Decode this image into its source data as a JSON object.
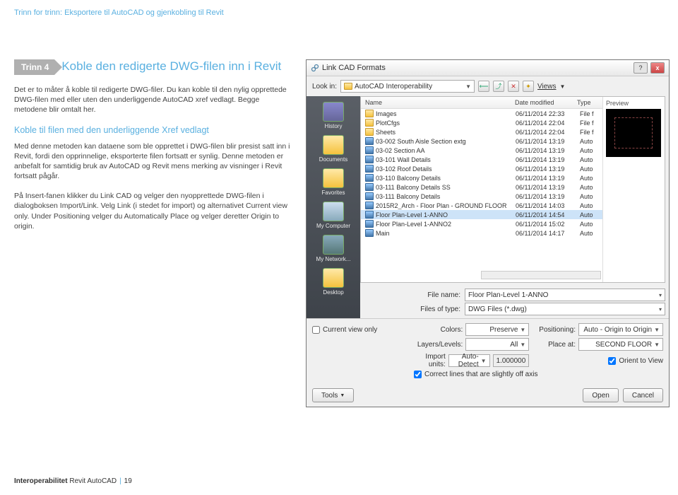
{
  "page": {
    "header": "Trinn for trinn: Eksportere til AutoCAD og gjenkobling til Revit",
    "footer_bold": "Interoperabilitet",
    "footer_regular": " Revit AutoCAD",
    "footer_page": "19"
  },
  "step": {
    "badge": "Trinn 4",
    "title": "Koble den redigerte DWG-filen inn i Revit",
    "p1": "Det er to måter å koble til redigerte DWG-filer. Du kan koble til den nylig opprettede DWG-filen med eller uten den underliggende AutoCAD xref vedlagt. Begge metodene blir omtalt her.",
    "sub2": "Koble til filen med den underliggende Xref vedlagt",
    "p2": "Med denne metoden kan dataene som ble opprettet i DWG-filen blir presist satt inn i Revit, fordi den opprinnelige, eksporterte filen fortsatt er synlig. Denne metoden er anbefalt for samtidig bruk av AutoCAD og Revit mens merking av visninger i Revit fortsatt pågår.",
    "p3": "På Insert-fanen klikker du Link CAD og velger den nyopprettede DWG-filen i dialogboksen Import/Link. Velg Link (i stedet for import) og alternativet Current view only. Under Positioning velger du Automatically Place og velger deretter Origin to origin."
  },
  "dialog": {
    "title": "Link CAD Formats",
    "lookin_label": "Look in:",
    "lookin_value": "AutoCAD Interoperability",
    "views_label": "Views",
    "preview_label": "Preview",
    "places": {
      "history": "History",
      "documents": "Documents",
      "favorites": "Favorites",
      "mycomputer": "My Computer",
      "mynetwork": "My Network...",
      "desktop": "Desktop"
    },
    "cols": {
      "name": "Name",
      "date": "Date modified",
      "type": "Type"
    },
    "files": [
      {
        "icon": "folder",
        "name": "Images",
        "date": "06/11/2014 22:33",
        "type": "File f"
      },
      {
        "icon": "folder",
        "name": "PlotCfgs",
        "date": "06/11/2014 22:04",
        "type": "File f"
      },
      {
        "icon": "folder",
        "name": "Sheets",
        "date": "06/11/2014 22:04",
        "type": "File f"
      },
      {
        "icon": "dwg",
        "name": "03-002 South Aisle Section extg",
        "date": "06/11/2014 13:19",
        "type": "Auto"
      },
      {
        "icon": "dwg",
        "name": "03-02 Section AA",
        "date": "06/11/2014 13:19",
        "type": "Auto"
      },
      {
        "icon": "dwg",
        "name": "03-101 Wall Details",
        "date": "06/11/2014 13:19",
        "type": "Auto"
      },
      {
        "icon": "dwg",
        "name": "03-102 Roof Details",
        "date": "06/11/2014 13:19",
        "type": "Auto"
      },
      {
        "icon": "dwg",
        "name": "03-110 Balcony Details",
        "date": "06/11/2014 13:19",
        "type": "Auto"
      },
      {
        "icon": "dwg",
        "name": "03-111 Balcony Details SS",
        "date": "06/11/2014 13:19",
        "type": "Auto"
      },
      {
        "icon": "dwg",
        "name": "03-111 Balcony Details",
        "date": "06/11/2014 13:19",
        "type": "Auto"
      },
      {
        "icon": "dwg",
        "name": "2015R2_Arch - Floor Plan - GROUND FLOOR",
        "date": "06/11/2014 14:03",
        "type": "Auto"
      },
      {
        "icon": "dwg",
        "name": "Floor Plan-Level 1-ANNO",
        "date": "06/11/2014 14:54",
        "type": "Auto",
        "selected": true
      },
      {
        "icon": "dwg",
        "name": "Floor Plan-Level 1-ANNO2",
        "date": "06/11/2014 15:02",
        "type": "Auto"
      },
      {
        "icon": "dwg",
        "name": "Main",
        "date": "06/11/2014 14:17",
        "type": "Auto"
      }
    ],
    "filename_label": "File name:",
    "filename_value": "Floor Plan-Level 1-ANNO",
    "filetype_label": "Files of type:",
    "filetype_value": "DWG Files (*.dwg)",
    "opts": {
      "current_view": "Current view only",
      "colors_label": "Colors:",
      "colors_value": "Preserve",
      "layers_label": "Layers/Levels:",
      "layers_value": "All",
      "import_units_label": "Import units:",
      "import_units_value": "Auto-Detect",
      "units_factor": "1.000000",
      "positioning_label": "Positioning:",
      "positioning_value": "Auto - Origin to Origin",
      "place_at_label": "Place at:",
      "place_at_value": "SECOND FLOOR",
      "orient_to_view": "Orient to View",
      "correct_lines": "Correct lines that are slightly off axis"
    },
    "buttons": {
      "tools": "Tools",
      "open": "Open",
      "cancel": "Cancel"
    }
  }
}
